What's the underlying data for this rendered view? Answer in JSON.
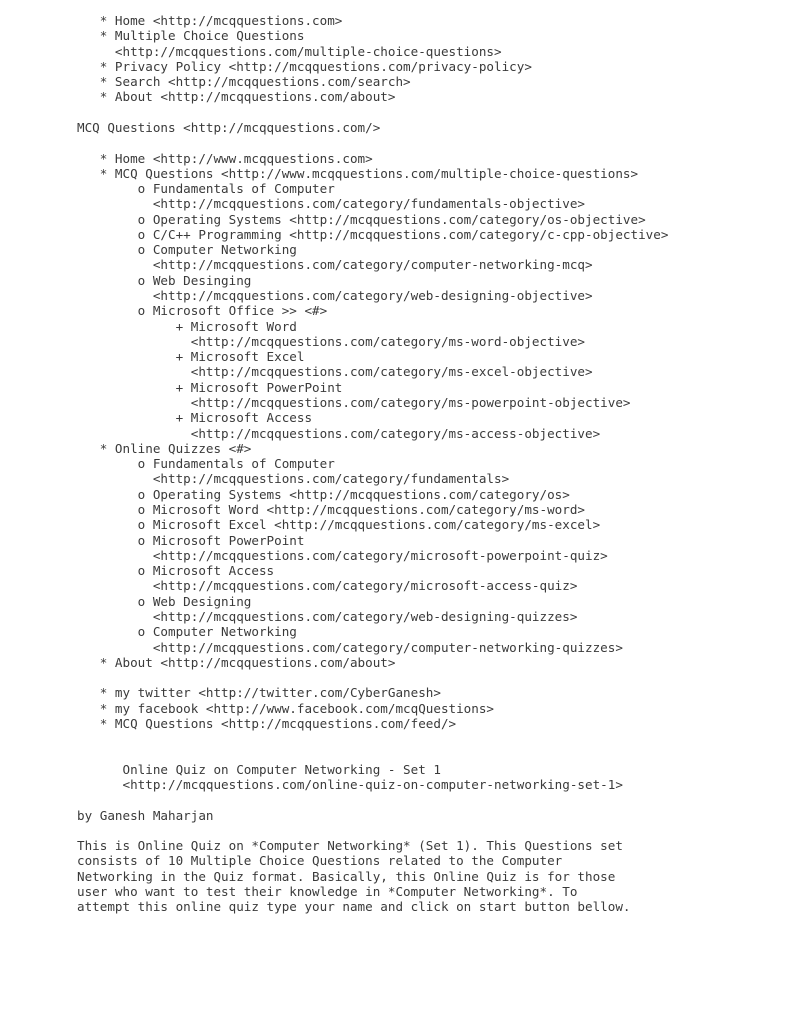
{
  "document": {
    "kind": "plain-text-page",
    "background_color": "#ffffff",
    "text_color": "#3a3a3a",
    "title": "MCQ Questions",
    "site_url": "http://mcqquestions.com/"
  },
  "top_nav": {
    "items": [
      {
        "bullet": "*",
        "label": "Home",
        "url": "http://mcqquestions.com"
      },
      {
        "bullet": "*",
        "label": "Multiple Choice Questions",
        "url": "http://mcqquestions.com/multiple-choice-questions"
      },
      {
        "bullet": "*",
        "label": "Privacy Policy",
        "url": "http://mcqquestions.com/privacy-policy"
      },
      {
        "bullet": "*",
        "label": "Search",
        "url": "http://mcqquestions.com/search"
      },
      {
        "bullet": "*",
        "label": "About",
        "url": "http://mcqquestions.com/about"
      }
    ]
  },
  "site_heading": {
    "label": "MCQ Questions",
    "url": "http://mcqquestions.com/"
  },
  "main_nav": {
    "items": [
      {
        "bullet": "*",
        "label": "Home",
        "url": "http://www.mcqquestions.com"
      },
      {
        "bullet": "*",
        "label": "MCQ Questions",
        "url": "http://www.mcqquestions.com/multiple-choice-questions"
      }
    ],
    "mcq_children": [
      {
        "bullet": "o",
        "label": "Fundamentals of Computer",
        "url": "http://mcqquestions.com/category/fundamentals-objective"
      },
      {
        "bullet": "o",
        "label": "Operating Systems",
        "url": "http://mcqquestions.com/category/os-objective"
      },
      {
        "bullet": "o",
        "label": "C/C++ Programming",
        "url": "http://mcqquestions.com/category/c-cpp-objective"
      },
      {
        "bullet": "o",
        "label": "Computer Networking",
        "url": "http://mcqquestions.com/category/computer-networking-mcq"
      },
      {
        "bullet": "o",
        "label": "Web Desinging",
        "url": "http://mcqquestions.com/category/web-designing-objective"
      },
      {
        "bullet": "o",
        "label": "Microsoft Office >>",
        "url": "#"
      }
    ],
    "office_children": [
      {
        "bullet": "+",
        "label": "Microsoft Word",
        "url": "http://mcqquestions.com/category/ms-word-objective"
      },
      {
        "bullet": "+",
        "label": "Microsoft Excel",
        "url": "http://mcqquestions.com/category/ms-excel-objective"
      },
      {
        "bullet": "+",
        "label": "Microsoft PowerPoint",
        "url": "http://mcqquestions.com/category/ms-powerpoint-objective"
      },
      {
        "bullet": "+",
        "label": "Microsoft Access",
        "url": "http://mcqquestions.com/category/ms-access-objective"
      }
    ],
    "online_quizzes": {
      "bullet": "*",
      "label": "Online Quizzes",
      "url": "#"
    },
    "quiz_children": [
      {
        "bullet": "o",
        "label": "Fundamentals of Computer",
        "url": "http://mcqquestions.com/category/fundamentals"
      },
      {
        "bullet": "o",
        "label": "Operating Systems",
        "url": "http://mcqquestions.com/category/os"
      },
      {
        "bullet": "o",
        "label": "Microsoft Word",
        "url": "http://mcqquestions.com/category/ms-word"
      },
      {
        "bullet": "o",
        "label": "Microsoft Excel",
        "url": "http://mcqquestions.com/category/ms-excel"
      },
      {
        "bullet": "o",
        "label": "Microsoft PowerPoint",
        "url": "http://mcqquestions.com/category/microsoft-powerpoint-quiz"
      },
      {
        "bullet": "o",
        "label": "Microsoft Access",
        "url": "http://mcqquestions.com/category/microsoft-access-quiz"
      },
      {
        "bullet": "o",
        "label": "Web Designing",
        "url": "http://mcqquestions.com/category/web-designing-quizzes"
      },
      {
        "bullet": "o",
        "label": "Computer Networking",
        "url": "http://mcqquestions.com/category/computer-networking-quizzes"
      }
    ],
    "about": {
      "bullet": "*",
      "label": "About",
      "url": "http://mcqquestions.com/about"
    }
  },
  "social_nav": {
    "items": [
      {
        "bullet": "*",
        "label": "my twitter",
        "url": "http://twitter.com/CyberGanesh"
      },
      {
        "bullet": "*",
        "label": "my facebook",
        "url": "http://www.facebook.com/mcqQuestions"
      },
      {
        "bullet": "*",
        "label": "MCQ Questions",
        "url": "http://mcqquestions.com/feed/"
      }
    ]
  },
  "article": {
    "heading": "Online Quiz on Computer Networking - Set 1",
    "heading_url": "http://mcqquestions.com/online-quiz-on-computer-networking-set-1",
    "byline": "by Ganesh Maharjan",
    "body_lines": [
      "This is Online Quiz on *Computer Networking* (Set 1). This Questions set",
      "consists of 10 Multiple Choice Questions related to the Computer",
      "Networking in the Quiz format. Basically, this Online Quiz is for those",
      "user who want to test their knowledge in *Computer Networking*. To",
      "attempt this online quiz type your name and click on start button bellow."
    ]
  },
  "rendered_lines": [
    "   * Home <http://mcqquestions.com>",
    "   * Multiple Choice Questions",
    "     <http://mcqquestions.com/multiple-choice-questions>",
    "   * Privacy Policy <http://mcqquestions.com/privacy-policy>",
    "   * Search <http://mcqquestions.com/search>",
    "   * About <http://mcqquestions.com/about>",
    "",
    "MCQ Questions <http://mcqquestions.com/>",
    "",
    "   * Home <http://www.mcqquestions.com>",
    "   * MCQ Questions <http://www.mcqquestions.com/multiple-choice-questions>",
    "        o Fundamentals of Computer",
    "          <http://mcqquestions.com/category/fundamentals-objective>",
    "        o Operating Systems <http://mcqquestions.com/category/os-objective>",
    "        o C/C++ Programming <http://mcqquestions.com/category/c-cpp-objective>",
    "        o Computer Networking",
    "          <http://mcqquestions.com/category/computer-networking-mcq>",
    "        o Web Desinging",
    "          <http://mcqquestions.com/category/web-designing-objective>",
    "        o Microsoft Office >> <#>",
    "             + Microsoft Word",
    "               <http://mcqquestions.com/category/ms-word-objective>",
    "             + Microsoft Excel",
    "               <http://mcqquestions.com/category/ms-excel-objective>",
    "             + Microsoft PowerPoint",
    "               <http://mcqquestions.com/category/ms-powerpoint-objective>",
    "             + Microsoft Access",
    "               <http://mcqquestions.com/category/ms-access-objective>",
    "   * Online Quizzes <#>",
    "        o Fundamentals of Computer",
    "          <http://mcqquestions.com/category/fundamentals>",
    "        o Operating Systems <http://mcqquestions.com/category/os>",
    "        o Microsoft Word <http://mcqquestions.com/category/ms-word>",
    "        o Microsoft Excel <http://mcqquestions.com/category/ms-excel>",
    "        o Microsoft PowerPoint",
    "          <http://mcqquestions.com/category/microsoft-powerpoint-quiz>",
    "        o Microsoft Access",
    "          <http://mcqquestions.com/category/microsoft-access-quiz>",
    "        o Web Designing",
    "          <http://mcqquestions.com/category/web-designing-quizzes>",
    "        o Computer Networking",
    "          <http://mcqquestions.com/category/computer-networking-quizzes>",
    "   * About <http://mcqquestions.com/about>",
    "",
    "   * my twitter <http://twitter.com/CyberGanesh>",
    "   * my facebook <http://www.facebook.com/mcqQuestions>",
    "   * MCQ Questions <http://mcqquestions.com/feed/>",
    "",
    "",
    "      Online Quiz on Computer Networking - Set 1",
    "      <http://mcqquestions.com/online-quiz-on-computer-networking-set-1>",
    "",
    "by Ganesh Maharjan",
    "",
    "This is Online Quiz on *Computer Networking* (Set 1). This Questions set",
    "consists of 10 Multiple Choice Questions related to the Computer",
    "Networking in the Quiz format. Basically, this Online Quiz is for those",
    "user who want to test their knowledge in *Computer Networking*. To",
    "attempt this online quiz type your name and click on start button bellow."
  ]
}
